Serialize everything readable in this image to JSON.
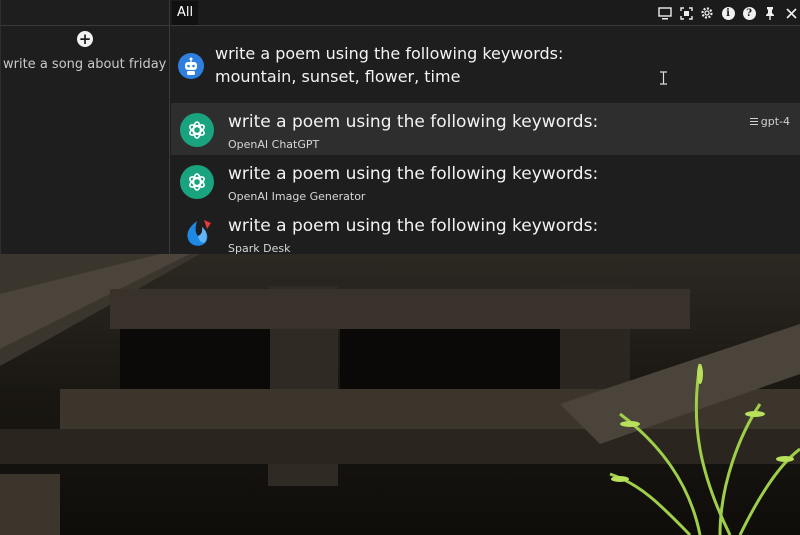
{
  "sidebar": {
    "new_chat_icon": "plus-circle-icon",
    "history": [
      "write a song about friday"
    ]
  },
  "topbar": {
    "tabs": [
      {
        "label": "All",
        "active": true
      }
    ],
    "toolbar_icons": [
      "monitor-icon",
      "scan-icon",
      "gear-icon",
      "info-icon",
      "help-icon",
      "pin-icon",
      "close-icon"
    ]
  },
  "query": {
    "avatar_icon": "robot-icon",
    "lines": [
      "write a poem using the following keywords:",
      "mountain, sunset, flower, time"
    ]
  },
  "results": [
    {
      "title": "write a poem using the following keywords:",
      "subtitle": "OpenAI ChatGPT",
      "icon": "openai-icon",
      "model": "gpt-4",
      "selected": true
    },
    {
      "title": "write a poem using the following keywords:",
      "subtitle": "OpenAI Image Generator",
      "icon": "openai-icon",
      "selected": false
    },
    {
      "title": "write a poem using the following keywords:",
      "subtitle": "Spark Desk",
      "icon": "spark-icon",
      "selected": false
    }
  ],
  "colors": {
    "window_bg": "#1e1e1e",
    "selected_row": "#2e2e2e",
    "openai_green": "#19a37f",
    "avatar_blue": "#2e7fe0"
  }
}
